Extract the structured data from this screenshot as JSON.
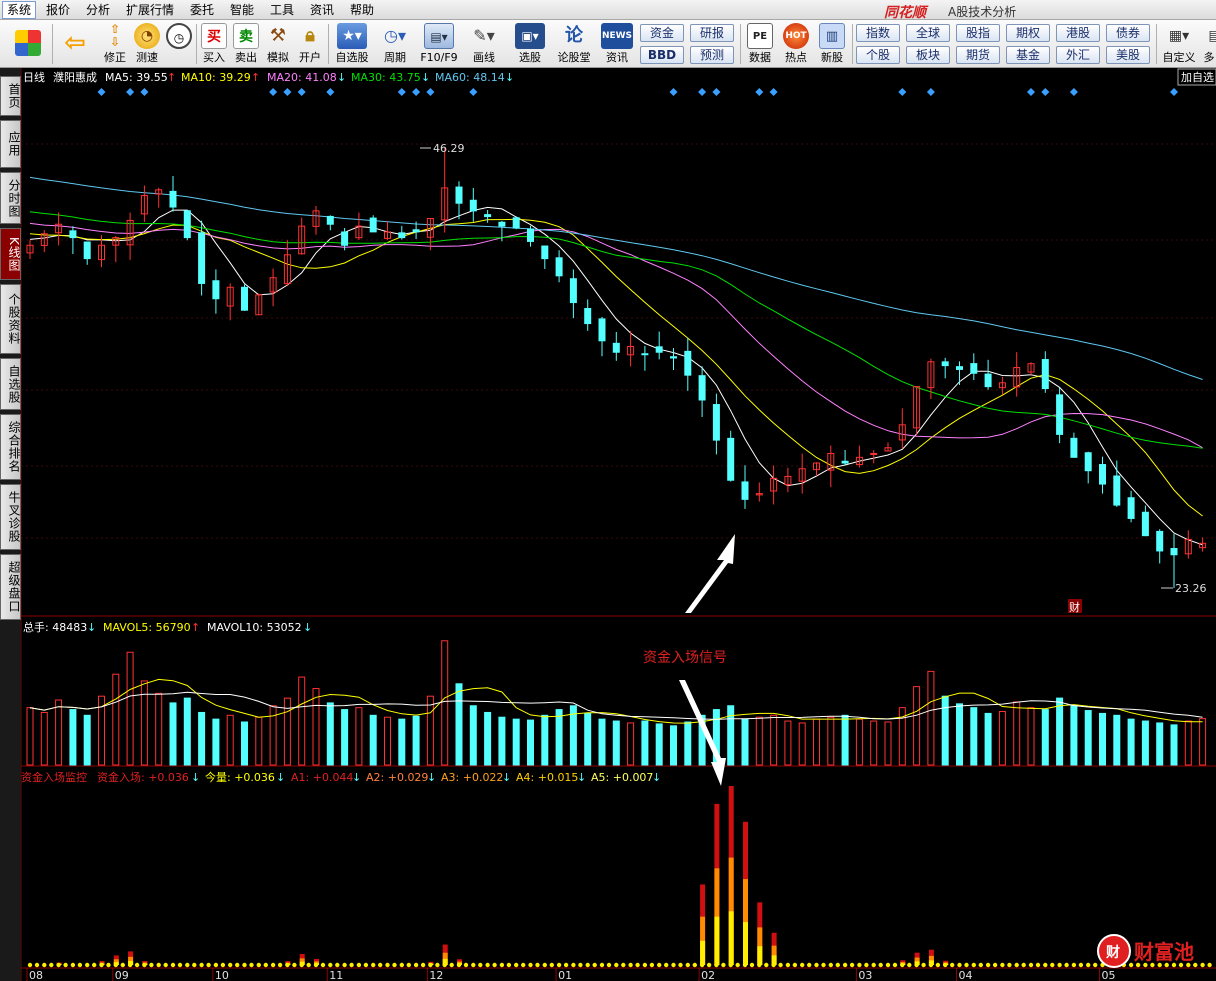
{
  "menubar": {
    "items": [
      "系统",
      "报价",
      "分析",
      "扩展行情",
      "委托",
      "智能",
      "工具",
      "资讯",
      "帮助"
    ],
    "brand": "同花顺",
    "subtitle": "A股技术分析"
  },
  "toolbar": {
    "buttons": [
      {
        "label": "",
        "icon": "home-grid-icon"
      },
      {
        "label": "",
        "icon": "back-arrow-icon"
      },
      {
        "label": "修正",
        "icon": "up-down-icon"
      },
      {
        "label": "测速",
        "icon": "speed-icon"
      },
      {
        "label": "买入",
        "icon": "buy-icon"
      },
      {
        "label": "卖出",
        "icon": "sell-icon"
      },
      {
        "label": "模拟",
        "icon": "hammer-icon"
      },
      {
        "label": "开户",
        "icon": "lock-icon"
      },
      {
        "label": "自选股",
        "icon": "star-icon"
      },
      {
        "label": "周期",
        "icon": "clock-icon"
      },
      {
        "label": "F10/F9",
        "icon": "f10-icon"
      },
      {
        "label": "画线",
        "icon": "pen-icon"
      },
      {
        "label": "选股",
        "icon": "monitor-icon"
      },
      {
        "label": "论股堂",
        "icon": "forum-icon"
      },
      {
        "label": "资讯",
        "icon": "news-icon"
      },
      {
        "label": "数据",
        "icon": "pe-icon"
      },
      {
        "label": "热点",
        "icon": "hot-icon"
      },
      {
        "label": "新股",
        "icon": "ipo-icon"
      },
      {
        "label": "自定义",
        "icon": "custom-icon"
      },
      {
        "label": "多",
        "icon": ""
      }
    ],
    "icon_glyphs": {
      "buy": "买",
      "sell": "卖",
      "news": "NEWS",
      "pe": "PE",
      "forum": "论"
    },
    "mini_buttons": [
      "资金",
      "研报",
      "BBD",
      "预测"
    ],
    "market_buttons": [
      "指数",
      "全球",
      "股指",
      "期权",
      "港股",
      "债券",
      "个股",
      "板块",
      "期货",
      "基金",
      "外汇",
      "美股"
    ],
    "add_watch": "加自选"
  },
  "sidebar": {
    "tabs": [
      "首页",
      "应用",
      "分时图",
      "K线图",
      "个股资料",
      "自选股",
      "综合排名",
      "牛叉诊股",
      "超级盘口"
    ],
    "active_index": 3
  },
  "kline_header": {
    "period": "日线",
    "stock": "濮阳惠成",
    "ma5": "MA5: 39.55",
    "ma10": "MA10: 39.29",
    "ma20": "MA20: 41.08",
    "ma30": "MA30: 43.75",
    "ma60": "MA60: 48.14"
  },
  "kline_annotations": {
    "high": "46.29",
    "low": "23.26",
    "cai": "财"
  },
  "volume_header": {
    "total": "总手: 48483",
    "mavol5": "MAVOL5: 56790",
    "mavol10": "MAVOL10: 53052"
  },
  "volume_note": "资金入场信号",
  "indicator_header": {
    "name": "资金入场监控",
    "entry": "资金入场: +0.036",
    "today": "今量: +0.036",
    "a1": "A1: +0.044",
    "a2": "A2: +0.029",
    "a3": "A3: +0.022",
    "a4": "A4: +0.015",
    "a5": "A5: +0.007"
  },
  "month_labels": [
    "08",
    "09",
    "10",
    "11",
    "12",
    "01",
    "02",
    "03",
    "04",
    "05"
  ],
  "watermark": "财富池",
  "colors": {
    "up": "#ff3232",
    "down": "#54ffff",
    "ma5": "#ffffff",
    "ma10": "#ffff00",
    "ma20": "#ff80ff",
    "ma30": "#00e000",
    "ma60": "#5fc8f0",
    "accent_red": "#e02020"
  },
  "chart_data": {
    "type": "candlestick",
    "price_range": [
      23.26,
      46.29
    ],
    "close_series": [
      41.2,
      41.8,
      42.3,
      41.6,
      40.5,
      41.2,
      41.6,
      42.5,
      43.8,
      44.1,
      43.2,
      41.6,
      39.2,
      38.4,
      39.0,
      37.8,
      38.6,
      39.5,
      40.7,
      42.2,
      43.0,
      42.3,
      41.2,
      42.2,
      41.9,
      41.9,
      41.6,
      41.9,
      42.6,
      44.2,
      43.4,
      43.0,
      42.7,
      42.2,
      42.1,
      41.4,
      40.5,
      39.6,
      38.2,
      37.1,
      36.2,
      35.6,
      35.9,
      35.5,
      35.6,
      35.3,
      34.4,
      33.1,
      31.0,
      28.9,
      27.9,
      28.2,
      29.0,
      29.1,
      29.5,
      29.8,
      30.3,
      29.8,
      30.1,
      30.3,
      30.6,
      31.8,
      33.8,
      35.1,
      34.9,
      34.7,
      34.5,
      33.8,
      34.0,
      34.8,
      35.0,
      33.7,
      31.3,
      30.1,
      29.4,
      28.7,
      27.6,
      26.9,
      26.0,
      25.2,
      25.0,
      25.8,
      25.6
    ],
    "volume": [
      60000,
      55000,
      68000,
      58000,
      52000,
      72000,
      95000,
      118000,
      88000,
      75000,
      65000,
      70000,
      55000,
      48000,
      52000,
      45000,
      50000,
      62000,
      70000,
      92000,
      80000,
      65000,
      58000,
      60000,
      52000,
      50000,
      48000,
      51000,
      72000,
      130000,
      85000,
      62000,
      55000,
      50000,
      48000,
      47000,
      52000,
      58000,
      62000,
      54000,
      48000,
      46000,
      44000,
      46000,
      43000,
      41000,
      45000,
      52000,
      58000,
      62000,
      48000,
      50000,
      52000,
      46000,
      44000,
      48000,
      50000,
      52000,
      48000,
      46000,
      45000,
      60000,
      82000,
      98000,
      72000,
      64000,
      60000,
      54000,
      56000,
      66000,
      60000,
      58000,
      70000,
      62000,
      57000,
      54000,
      52000,
      48000,
      46000,
      44000,
      42000,
      46000,
      48483
    ],
    "ma_latest": {
      "MA5": 39.55,
      "MA10": 39.29,
      "MA20": 41.08,
      "MA30": 43.75,
      "MA60": 48.14
    },
    "volume_ma_latest": {
      "MAVOL5": 56790,
      "MAVOL10": 53052
    },
    "indicator_latest": {
      "资金入场": 0.036,
      "今量": 0.036,
      "A1": 0.044,
      "A2": 0.029,
      "A3": 0.022,
      "A4": 0.015,
      "A5": 0.007
    },
    "signal_note": "资金入场信号"
  }
}
